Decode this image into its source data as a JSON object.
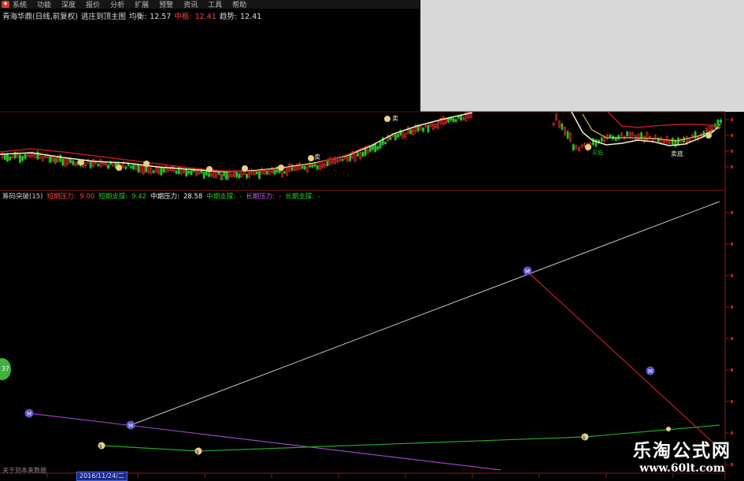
{
  "menu": [
    "系统",
    "功能",
    "深度",
    "报价",
    "分析",
    "扩展",
    "预警",
    "资讯",
    "工具",
    "帮助"
  ],
  "info_line": {
    "stock": "青海华鼎(日线,前复权)",
    "mode": "逃庄到顶主图",
    "avg_label": "均衡:",
    "avg_value": "12.57",
    "mid_label": "中枢:",
    "mid_value": "12.41",
    "trend_label": "趋势:",
    "trend_value": "12.41"
  },
  "indicator_legend": {
    "name": "筹码突破(15)",
    "short_pressure_label": "短期压力:",
    "short_pressure_value": "9.00",
    "short_support_label": "短期支撑:",
    "short_support_value": "9.42",
    "mid_pressure_label": "中期压力:",
    "mid_pressure_value": "28.58",
    "mid_support_label": "中期支撑:",
    "mid_support_dash": "-",
    "long_pressure_label": "长期压力:",
    "long_pressure_dash": "-",
    "long_support_label": "长期支撑:",
    "long_support_dash": "-"
  },
  "main_chart_labels": {
    "sell": "卖",
    "buy": "买",
    "sell_low": "卖底",
    "buy_low": "买低"
  },
  "green_circle_text": "37",
  "bottom_label": "关于到本来数据",
  "date_cursor": "2016/11/24/二",
  "watermark": {
    "title": "乐淘公式网",
    "url": "www.60lt.com"
  },
  "colors": {
    "background": "#000000",
    "up": "#ff3030",
    "down": "#22c622",
    "mid_pressure_line": "#c8c8c8",
    "short_pressure_line": "#a040c0",
    "support_line": "#22aa22",
    "resist_line": "#c02020",
    "marker_purple": "#5a55c8",
    "marker_yellow": "#e6d08a"
  },
  "chart_data": {
    "type": "line",
    "title": "",
    "series": [
      {
        "name": "中期压力",
        "values": []
      },
      {
        "name": "短期压力",
        "values": []
      },
      {
        "name": "短期支撑",
        "values": []
      }
    ]
  }
}
